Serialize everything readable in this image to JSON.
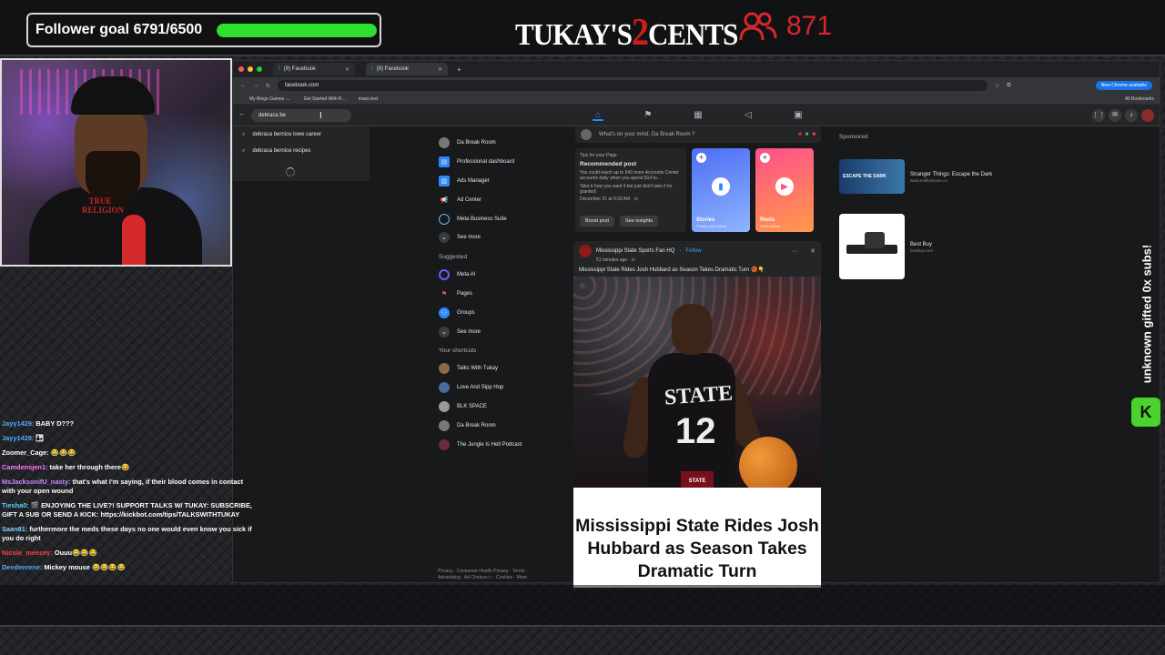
{
  "overlay": {
    "follower_goal_label": "Follower goal 6791/6500",
    "follower_goal_progress": 1.0,
    "brand_pre": "TUKAY'S",
    "brand_two": "2",
    "brand_post": "CENTS",
    "viewer_count": "871",
    "webcam_shirt_text": "TRUE RELIGION",
    "subs_vertical_text": "unknown gifted 0x subs!",
    "kick_badge_icon": "kick-icon",
    "accent_green": "#2ee02e",
    "accent_red": "#d8262d"
  },
  "browser": {
    "tabs": [
      {
        "label": "(9) Facebook"
      },
      {
        "label": "(9) Facebook"
      }
    ],
    "url": "facebook.com",
    "chrome_available": "New Chrome available",
    "bookmarks": [
      "My Bingo Games -...",
      "Get Started With R...",
      "mass text"
    ],
    "all_bookmarks": "All Bookmarks"
  },
  "fb": {
    "search_value": "debraca be",
    "suggestions": [
      "debraca bernice lowe career",
      "debraca bernice recipes"
    ],
    "left_nav": [
      {
        "label": "Da Break Room",
        "icon": "avatar-icon"
      },
      {
        "label": "Professional dashboard",
        "icon": "dashboard-icon"
      },
      {
        "label": "Ads Manager",
        "icon": "chart-icon"
      },
      {
        "label": "Ad Center",
        "icon": "megaphone-icon"
      },
      {
        "label": "Meta Business Suite",
        "icon": "meta-icon"
      },
      {
        "label": "See more",
        "icon": "chevron-down-icon"
      }
    ],
    "suggested_heading": "Suggested",
    "suggested": [
      {
        "label": "Meta AI",
        "icon": "meta-ai-icon"
      },
      {
        "label": "Pages",
        "icon": "flag-icon"
      },
      {
        "label": "Groups",
        "icon": "groups-icon"
      },
      {
        "label": "See more",
        "icon": "chevron-down-icon"
      }
    ],
    "shortcuts_heading": "Your shortcuts",
    "shortcuts": [
      {
        "label": "Talks With Tukay"
      },
      {
        "label": "Love And Sipp Hop"
      },
      {
        "label": "BLK SPACE"
      },
      {
        "label": "Da Break Room"
      },
      {
        "label": "The Jungle Is Hell Podcast"
      }
    ],
    "footer_line1": "Privacy · Consumer Health Privacy · Terms ·",
    "footer_line2": "Advertising · Ad Choices ▷ · Cookies · More",
    "composer_placeholder": "What's on your mind, Da Break Room ?",
    "tips": {
      "heading": "Tips for your Page",
      "title": "Recommended post",
      "body": "You could reach up to 543 more Accounts Center accounts daily when you spend $14 to...",
      "note": "Take it how you want it but just don't take it for granted!",
      "date": "December 21 at 9:33 AM · ⊙",
      "boost": "Boost post",
      "insights": "See insights"
    },
    "stories": {
      "label": "Stories",
      "sub": "Photos and videos"
    },
    "reels": {
      "label": "Reels",
      "sub": "Short videos"
    },
    "post": {
      "page": "Mississippi State Sports Fan HQ",
      "follow": "Follow",
      "time": "51 minutes ago · ⊙",
      "caption": "Mississippi State Rides Josh Hubbard as Season Takes Dramatic Turn 🏀👇",
      "jersey_text": "STATE",
      "jersey_number": "12",
      "logo_text": "STATE",
      "headline": "Mississippi State Rides Josh Hubbard as Season Takes Dramatic Turn"
    },
    "sponsored_heading": "Sponsored",
    "ads": [
      {
        "title": "Stranger Things: Escape the Dark",
        "url": "www.netflixhouse.co",
        "img_text": "ESCAPE THE DARK"
      },
      {
        "title": "Best Buy",
        "url": "bestbuy.com",
        "img_text": ""
      }
    ]
  },
  "chat": [
    {
      "user": "Jayy1429:",
      "text": "BABY D???",
      "color": "#5aa6ff"
    },
    {
      "user": "Jayy1429:",
      "text": "👨‍👧",
      "color": "#5aa6ff"
    },
    {
      "user": "Zoomer_Cage:",
      "text": "😂😂😂",
      "color": "#ffffff"
    },
    {
      "user": "Camdensjen1:",
      "text": "take her through there😂",
      "color": "#ff77ff"
    },
    {
      "user": "MsJacksonifU_nasty:",
      "text": "that's what I'm saying, if their blood comes in contact with your open wound",
      "color": "#c78bff"
    },
    {
      "user": "Tiesha0:",
      "text": "🎬 ENJOYING THE LIVE?! SUPPORT TALKS W/ TUKAY: SUBSCRIBE, GIFT A SUB OR SEND A KICK: https://kickbot.com/tips/TALKSWITHTUKAY",
      "color": "#53d5ff"
    },
    {
      "user": "Saan81:",
      "text": "furthermore the meds these days no one would even know you sick if you do right",
      "color": "#7dd2ff"
    },
    {
      "user": "Nicole_meesey:",
      "text": "Ouuu😂😂😂",
      "color": "#ff4040"
    },
    {
      "user": "Deedeerene:",
      "text": "Mickey mouse 😂😂😂😂",
      "color": "#5aa6ff"
    }
  ]
}
